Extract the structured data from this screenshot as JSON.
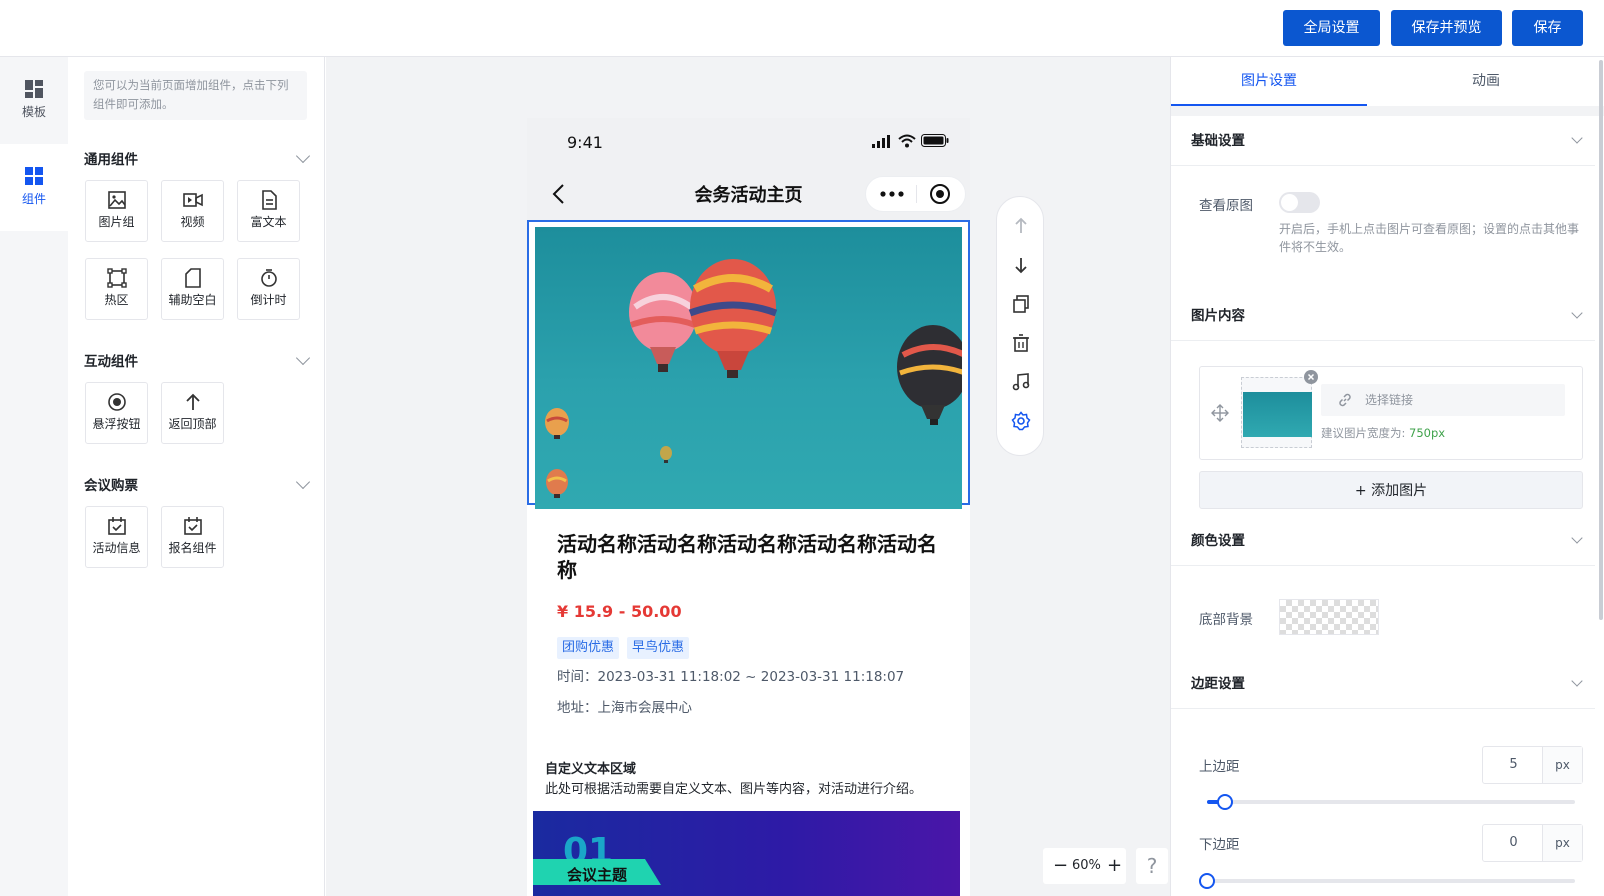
{
  "topbar": {
    "global_settings": "全局设置",
    "save_preview": "保存并预览",
    "save": "保存"
  },
  "nav": {
    "items": [
      {
        "label": "模板",
        "icon": "template-grid-icon",
        "active": false
      },
      {
        "label": "组件",
        "icon": "component-grid-icon",
        "active": true
      }
    ]
  },
  "components_panel": {
    "tip": "您可以为当前页面增加组件，点击下列组件即可添加。",
    "sections": [
      {
        "title": "通用组件",
        "items": [
          {
            "label": "图片组",
            "icon": "image-icon"
          },
          {
            "label": "视频",
            "icon": "video-icon"
          },
          {
            "label": "富文本",
            "icon": "document-icon"
          },
          {
            "label": "热区",
            "icon": "hotspot-icon"
          },
          {
            "label": "辅助空白",
            "icon": "blank-icon"
          },
          {
            "label": "倒计时",
            "icon": "timer-icon"
          }
        ]
      },
      {
        "title": "互动组件",
        "items": [
          {
            "label": "悬浮按钮",
            "icon": "float-button-icon"
          },
          {
            "label": "返回顶部",
            "icon": "arrow-up-icon"
          }
        ]
      },
      {
        "title": "会议购票",
        "items": [
          {
            "label": "活动信息",
            "icon": "calendar-icon"
          },
          {
            "label": "报名组件",
            "icon": "calendar-check-icon"
          }
        ]
      }
    ]
  },
  "phone": {
    "time": "9:41",
    "page_title": "会务活动主页",
    "event_title": "活动名称活动名称活动名称活动名称活动名称",
    "price": "¥ 15.9 - 50.00",
    "tags": [
      "团购优惠",
      "早鸟优惠"
    ],
    "time_info": "时间：2023-03-31 11:18:02 ~ 2023-03-31 11:18:07",
    "address": "地址：上海市会展中心",
    "custom_title": "自定义文本区域",
    "custom_desc": "此处可根据活动需要自定义文本、图片等内容，对活动进行介绍。",
    "banner_number": "01",
    "banner_text": "会议主题"
  },
  "toolbar_icons": [
    "arrow-up-icon",
    "arrow-down-icon",
    "copy-icon",
    "delete-icon",
    "music-icon",
    "settings-icon"
  ],
  "zoom": {
    "level": "60%",
    "help": "?"
  },
  "settings": {
    "tabs": [
      {
        "label": "图片设置",
        "active": true
      },
      {
        "label": "动画",
        "active": false
      }
    ],
    "basic": {
      "title": "基础设置",
      "view_original_label": "查看原图",
      "view_original_on": false,
      "note": "开启后，手机上点击图片可查看原图；设置的点击其他事件将不生效。"
    },
    "content": {
      "title": "图片内容",
      "link_placeholder": "选择链接",
      "suggest_prefix": "建议图片宽度为:",
      "suggest_value": "750px",
      "add_image": "+ 添加图片"
    },
    "color": {
      "title": "颜色设置",
      "bottom_bg_label": "底部背景"
    },
    "margin": {
      "title": "边距设置",
      "top_label": "上边距",
      "top_value": "5",
      "bottom_label": "下边距",
      "bottom_value": "0",
      "unit": "px",
      "slider_max": 100
    }
  }
}
